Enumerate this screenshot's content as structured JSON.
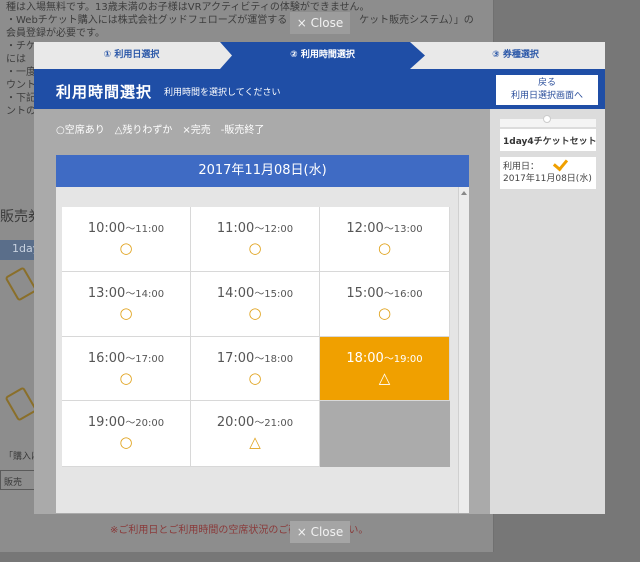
{
  "background": {
    "lines": [
      "種は入場無料です。13歳未満のお子様はVRアクティビティの体験ができません。",
      "・Webチケット購入には株式会社グッドフェローズが運営する「Web　　　　ケット販売システム）」の",
      "会員登録が必要です。",
      "・チケ",
      "には",
      "・一度",
      "ウント",
      "・下記",
      "ントの"
    ],
    "heading": "販売券",
    "tab": "1day",
    "note_small_1": "「購入は",
    "note_small_2": "販売",
    "bottom_note": "※ご利用日とご利用時間の空席状況のご確　　　　さい。"
  },
  "close_top": "× Close",
  "close_bottom": "× Close",
  "steps": [
    {
      "label": "① 利用日選択"
    },
    {
      "label": "② 利用時間選択"
    },
    {
      "label": "③ 券種選択"
    }
  ],
  "header": {
    "title": "利用時間選択",
    "subtitle": "利用時間を選択してください",
    "back_line1": "戻る",
    "back_line2": "利用日選択画面へ"
  },
  "legend": "○空席あり　△残りわずか　×完売　-販売終了",
  "date": "2017年11月08日(水)",
  "slots": [
    {
      "start": "10:00",
      "end": "〜11:00",
      "mark": "○"
    },
    {
      "start": "11:00",
      "end": "〜12:00",
      "mark": "○"
    },
    {
      "start": "12:00",
      "end": "〜13:00",
      "mark": "○"
    },
    {
      "start": "13:00",
      "end": "〜14:00",
      "mark": "○"
    },
    {
      "start": "14:00",
      "end": "〜15:00",
      "mark": "○"
    },
    {
      "start": "15:00",
      "end": "〜16:00",
      "mark": "○"
    },
    {
      "start": "16:00",
      "end": "〜17:00",
      "mark": "○"
    },
    {
      "start": "17:00",
      "end": "〜18:00",
      "mark": "○"
    },
    {
      "start": "18:00",
      "end": "〜19:00",
      "mark": "△"
    },
    {
      "start": "19:00",
      "end": "〜20:00",
      "mark": "○"
    },
    {
      "start": "20:00",
      "end": "〜21:00",
      "mark": "△"
    }
  ],
  "sidebar": {
    "ticket": "1day4チケットセット",
    "date_label": "利用日：",
    "date_value": "2017年11月08日(水)"
  },
  "colors": {
    "primary": "#1f4ea6",
    "date_bar": "#3f6bc4",
    "selected": "#f0a000",
    "mark": "#e0a31e"
  },
  "icons": [
    "check-icon",
    "ticket-icon",
    "scroll-up-icon"
  ]
}
